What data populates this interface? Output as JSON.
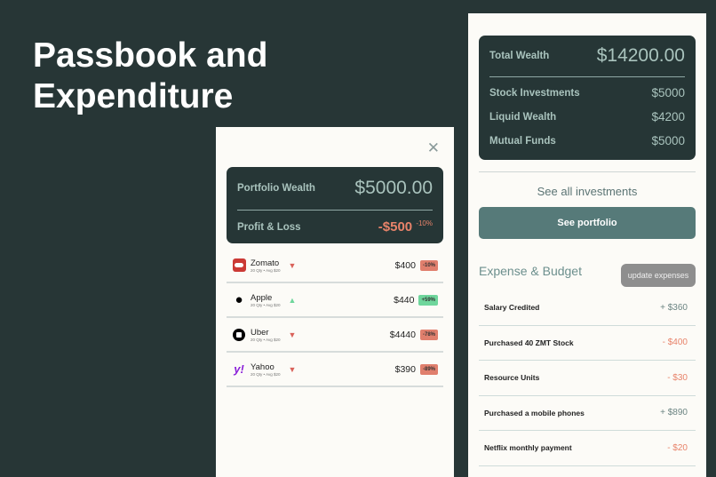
{
  "hero": {
    "line1": "Passbook and",
    "line2": "Expenditure"
  },
  "portfolio": {
    "close_icon": "close-icon",
    "wealth_label": "Portfolio Wealth",
    "wealth_value": "$5000.00",
    "pl_label": "Profit & Loss",
    "pl_value": "-$500",
    "pl_pct": "-10%",
    "stocks": [
      {
        "name": "Zomato",
        "sub": "20 Qty • Avg $20",
        "price": "$400",
        "change": "-10%",
        "trend": "down",
        "logo": "zomato-logo",
        "color": "#e07f6d"
      },
      {
        "name": "Apple",
        "sub": "20 Qty • Avg $20",
        "price": "$440",
        "change": "+59%",
        "trend": "up",
        "logo": "apple-logo",
        "color": "#6fd69c"
      },
      {
        "name": "Uber",
        "sub": "20 Qty • Avg $20",
        "price": "$4440",
        "change": "-78%",
        "trend": "down",
        "logo": "uber-logo",
        "color": "#e07f6d"
      },
      {
        "name": "Yahoo",
        "sub": "20 Qty • Avg $20",
        "price": "$390",
        "change": "-89%",
        "trend": "down",
        "logo": "yahoo-logo",
        "color": "#e07f6d"
      }
    ]
  },
  "wealth": {
    "total_label": "Total Wealth",
    "total_value": "$14200.00",
    "items": [
      {
        "label": "Stock Investments",
        "value": "$5000"
      },
      {
        "label": "Liquid Wealth",
        "value": "$4200"
      },
      {
        "label": "Mutual Funds",
        "value": "$5000"
      }
    ],
    "see_all": "See all investments",
    "see_portfolio": "See portfolio"
  },
  "expenses": {
    "title": "Expense & Budget",
    "update_button": "update expenses",
    "items": [
      {
        "name": "Salary Credited",
        "amount": "+ $360",
        "type": "credit"
      },
      {
        "name": "Purchased 40 ZMT Stock",
        "amount": "- $400",
        "type": "debit"
      },
      {
        "name": "Resource Units",
        "amount": "- $30",
        "type": "debit"
      },
      {
        "name": "Purchased a mobile phones",
        "amount": "+ $890",
        "type": "credit"
      },
      {
        "name": "Netflix monthly payment",
        "amount": "- $20",
        "type": "debit"
      }
    ]
  },
  "colors": {
    "credit": "#6c8583",
    "debit": "#e8836a",
    "down": "#d9625a",
    "up": "#6fd69c"
  }
}
